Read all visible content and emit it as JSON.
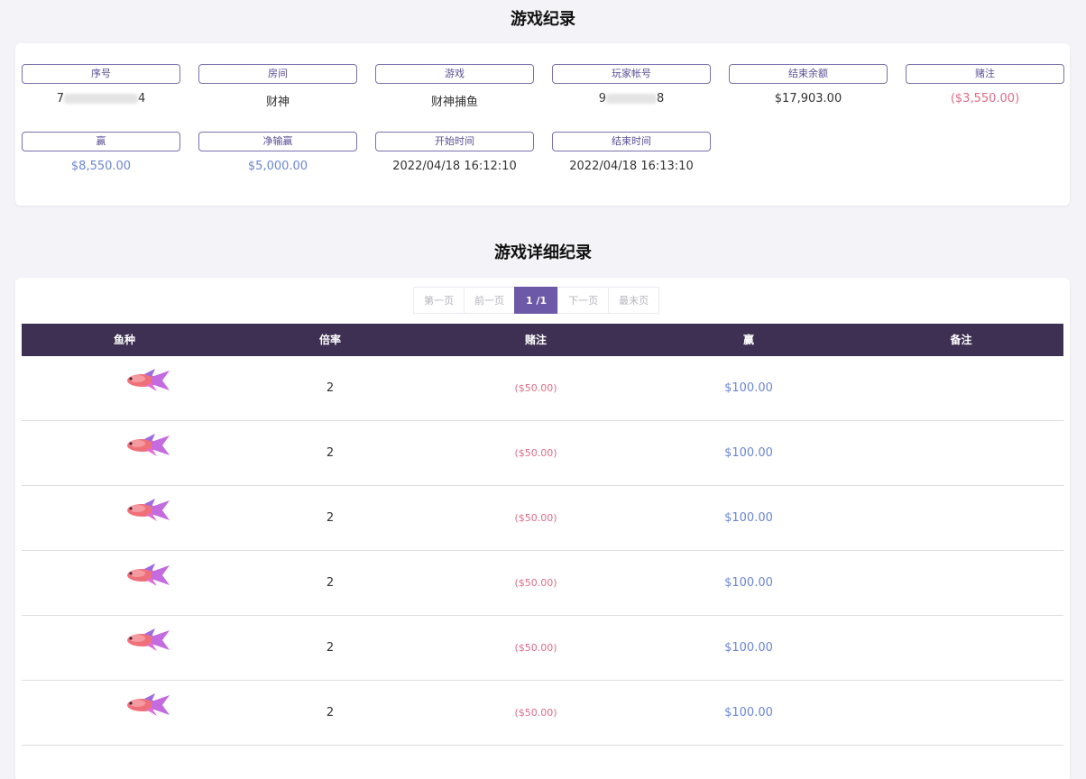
{
  "record_section": {
    "title": "游戏纪录",
    "fields": [
      {
        "label": "序号",
        "value_prefix": "7",
        "value_suffix": "4"
      },
      {
        "label": "房间",
        "value": "财神"
      },
      {
        "label": "游戏",
        "value": "财神捕鱼"
      },
      {
        "label": "玩家帐号",
        "value_prefix": "9",
        "value_suffix": "8"
      },
      {
        "label": "结束余额",
        "value": "$17,903.00"
      },
      {
        "label": "赌注",
        "value": "($3,550.00)"
      },
      {
        "label": "赢",
        "value": "$8,550.00"
      },
      {
        "label": "净输赢",
        "value": "$5,000.00"
      },
      {
        "label": "开始时间",
        "value": "2022/04/18 16:12:10"
      },
      {
        "label": "结束时间",
        "value": "2022/04/18 16:13:10"
      }
    ]
  },
  "detail_section": {
    "title": "游戏详细纪录",
    "pagination": {
      "first": "第一页",
      "prev": "前一页",
      "current": "1 /1",
      "next": "下一页",
      "last": "最末页"
    },
    "columns": {
      "fish": "鱼种",
      "multiplier": "倍率",
      "bet": "赌注",
      "win": "赢",
      "note": "备注"
    },
    "rows": [
      {
        "fish_icon": "pink-fish-icon",
        "multiplier": "2",
        "bet": "($50.00)",
        "win": "$100.00",
        "note": ""
      },
      {
        "fish_icon": "pink-fish-icon",
        "multiplier": "2",
        "bet": "($50.00)",
        "win": "$100.00",
        "note": ""
      },
      {
        "fish_icon": "pink-fish-icon",
        "multiplier": "2",
        "bet": "($50.00)",
        "win": "$100.00",
        "note": ""
      },
      {
        "fish_icon": "pink-fish-icon",
        "multiplier": "2",
        "bet": "($50.00)",
        "win": "$100.00",
        "note": ""
      },
      {
        "fish_icon": "pink-fish-icon",
        "multiplier": "2",
        "bet": "($50.00)",
        "win": "$100.00",
        "note": ""
      },
      {
        "fish_icon": "pink-fish-icon",
        "multiplier": "2",
        "bet": "($50.00)",
        "win": "$100.00",
        "note": ""
      }
    ]
  },
  "colors": {
    "accent": "#6c59a8",
    "header_bg": "#3d3052",
    "negative": "#e06b86",
    "positive": "#6b86d6"
  }
}
